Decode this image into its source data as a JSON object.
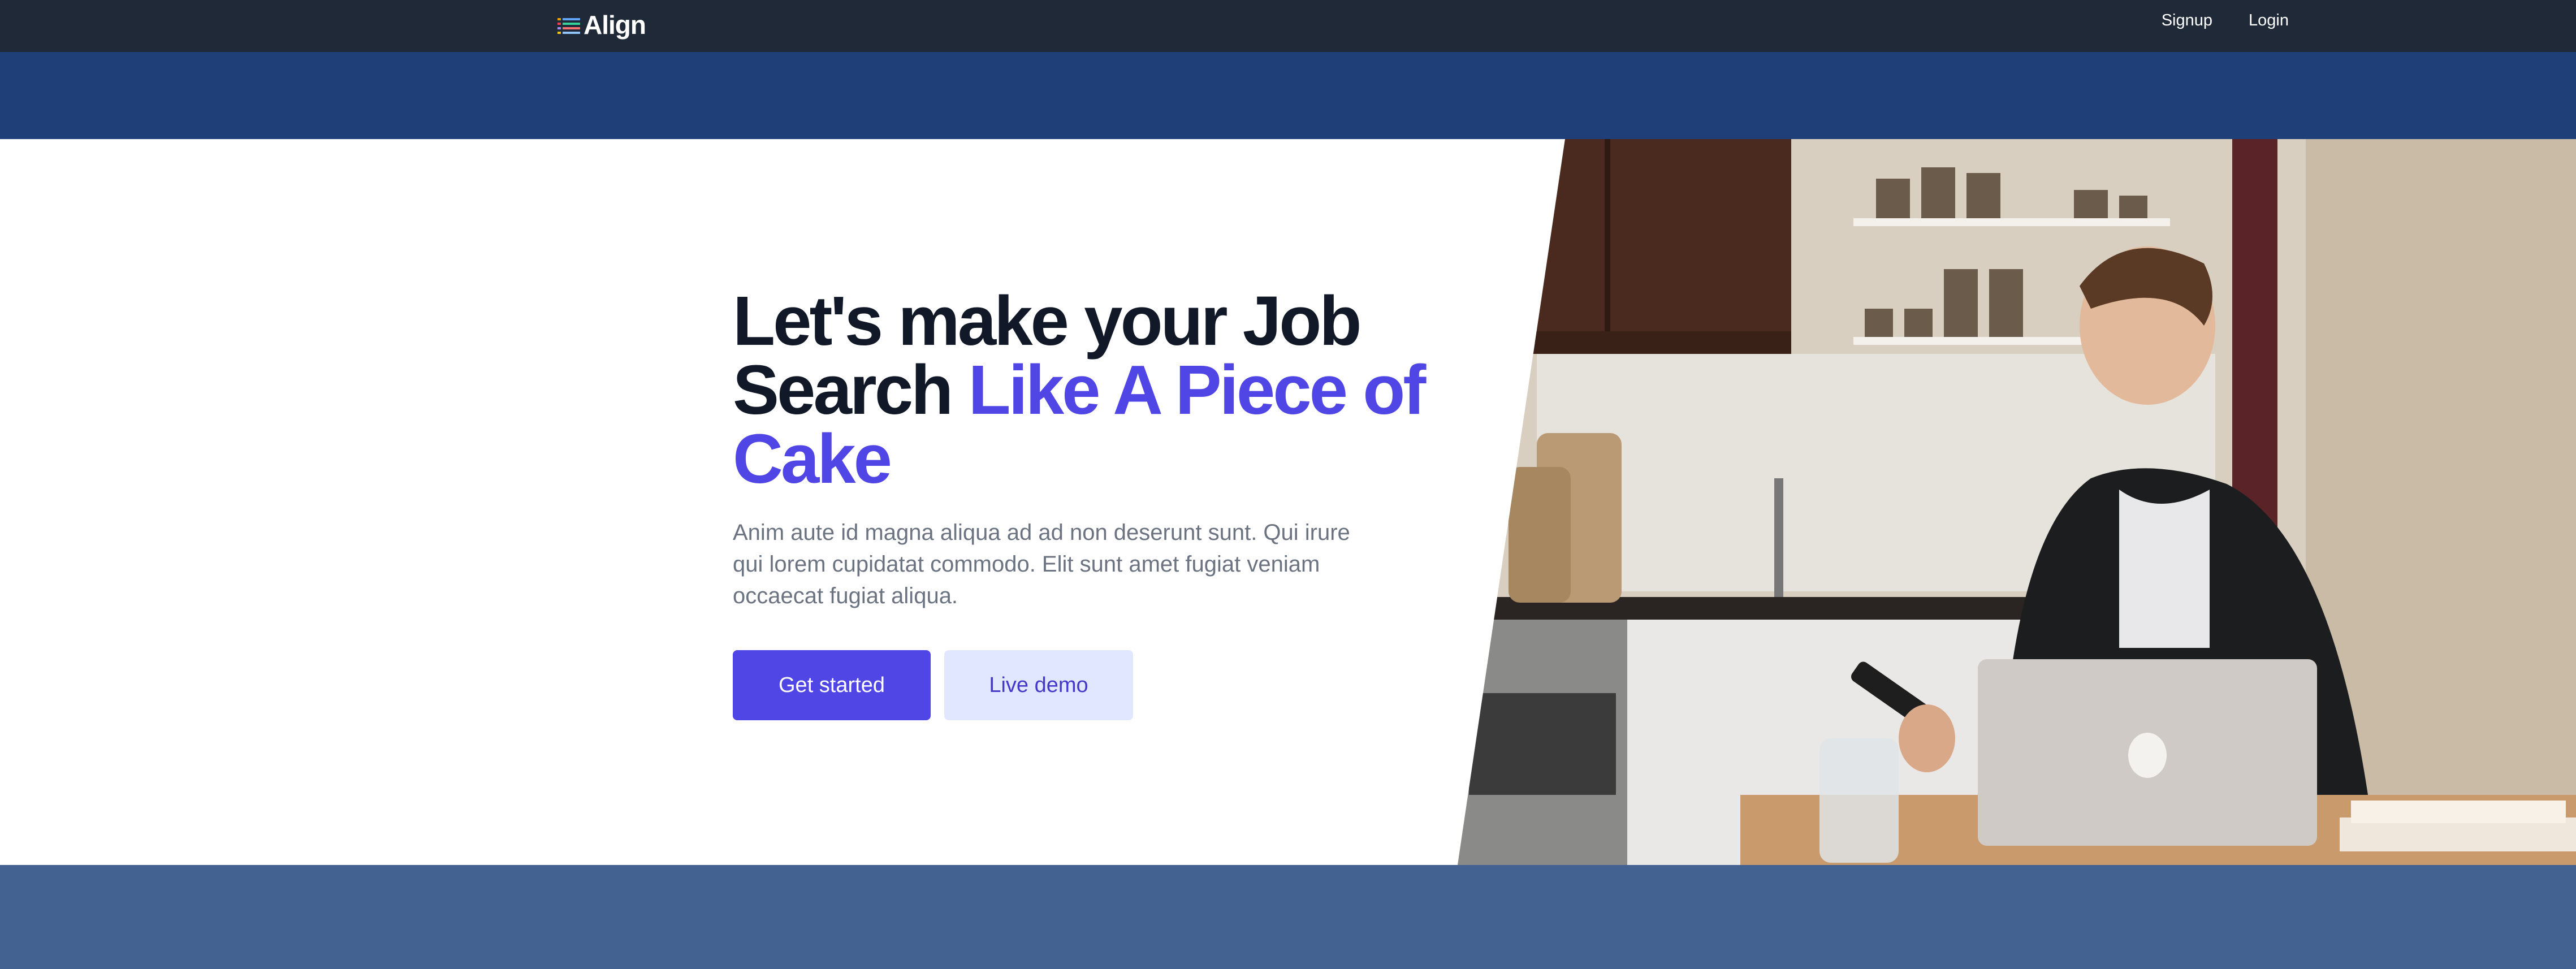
{
  "navbar": {
    "brand": "Align",
    "links": [
      "Signup",
      "Login"
    ]
  },
  "hero": {
    "headline_part1": "Let's make your Job Search ",
    "headline_accent": "Like A Piece of Cake",
    "lead": "Anim aute id magna aliqua ad ad non deserunt sunt. Qui irure qui lorem cupidatat commodo. Elit sunt amet fugiat veniam occaecat fugiat aliqua.",
    "primary_button": "Get started",
    "secondary_button": "Live demo"
  },
  "colors": {
    "navbar": "#1f2937",
    "band_top": "#1e3f78",
    "band_bottom": "#436291",
    "accent": "#4f46e5",
    "secondary_button_bg": "#e0e7ff"
  },
  "icons": {
    "logo": "list-lines-icon"
  }
}
